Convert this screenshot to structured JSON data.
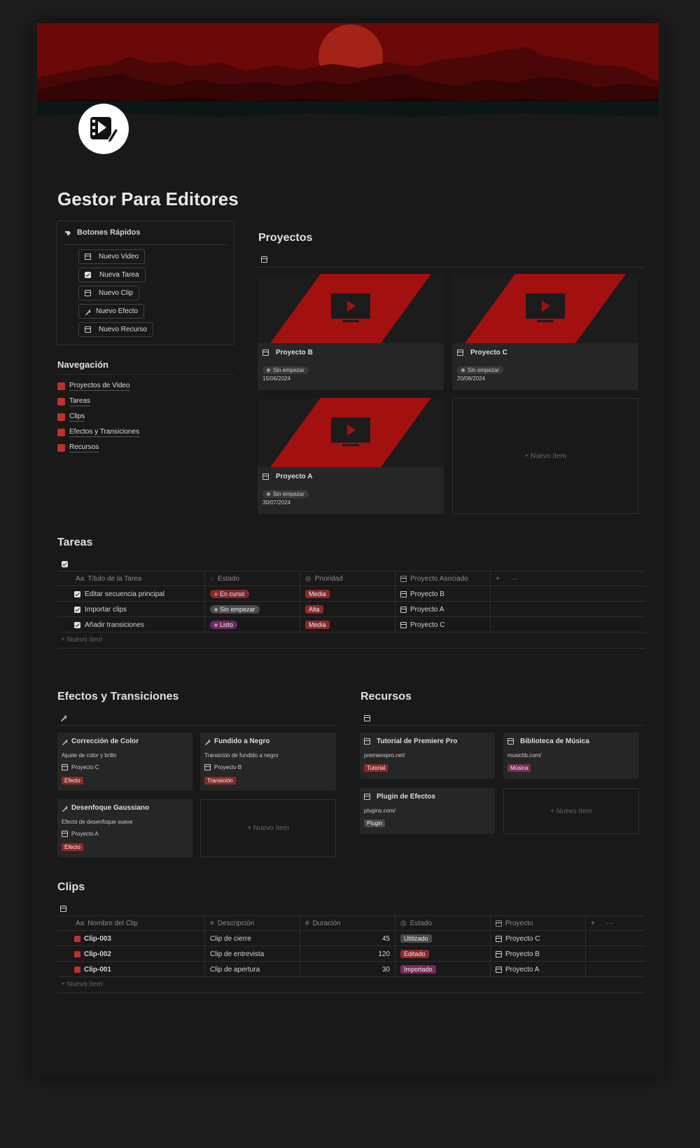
{
  "page": {
    "title": "Gestor Para Editores",
    "icon": "video-edit-icon"
  },
  "quick_buttons": {
    "title": "Botones Rápidos",
    "items": [
      {
        "label": "Nuevo Video",
        "icon": "page-icon"
      },
      {
        "label": "Nueva Tarea",
        "icon": "checkbox-icon"
      },
      {
        "label": "Nuevo Clip",
        "icon": "clapperboard-icon"
      },
      {
        "label": "Nuevo Efecto",
        "icon": "magic-wand-icon"
      },
      {
        "label": "Nuevo Recurso",
        "icon": "media-icon"
      }
    ]
  },
  "navigation": {
    "title": "Navegación",
    "items": [
      {
        "label": "Proyectos de Video"
      },
      {
        "label": "Tareas"
      },
      {
        "label": "Clips"
      },
      {
        "label": "Efectos y Transiciones"
      },
      {
        "label": "Recursos"
      }
    ]
  },
  "projects": {
    "title": "Proyectos",
    "cards": [
      {
        "name": "Proyecto B",
        "status": "Sin empezar",
        "date": "15/06/2024"
      },
      {
        "name": "Proyecto C",
        "status": "Sin empezar",
        "date": "20/08/2024"
      },
      {
        "name": "Proyecto A",
        "status": "Sin empezar",
        "date": "30/07/2024"
      }
    ],
    "new_item": "+ Nuevo ítem"
  },
  "tasks": {
    "title": "Tareas",
    "columns": [
      "Título de la Tarea",
      "Estado",
      "Prioridad",
      "Proyecto Asociado"
    ],
    "column_prefix": "Aa",
    "rows": [
      {
        "title": "Editar secuencia principal",
        "status": "En curso",
        "priority": "Media",
        "project": "Proyecto B"
      },
      {
        "title": "Importar clips",
        "status": "Sin empezar",
        "priority": "Alta",
        "project": "Proyecto A"
      },
      {
        "title": "Añadir transiciones",
        "status": "Listo",
        "priority": "Media",
        "project": "Proyecto C"
      }
    ],
    "add_col": "+",
    "more": "···",
    "new_item": "+ Nuevo ítem"
  },
  "effects": {
    "title": "Efectos y Transiciones",
    "cards": [
      {
        "name": "Corrección de Color",
        "desc": "Ajuste de color y brillo",
        "project": "Proyecto C",
        "tag": "Efecto"
      },
      {
        "name": "Fundido a Negro",
        "desc": "Transición de fundido a negro",
        "project": "Proyecto B",
        "tag": "Transición"
      },
      {
        "name": "Desenfoque Gaussiano",
        "desc": "Efecto de desenfoque suave",
        "project": "Proyecto A",
        "tag": "Efecto"
      }
    ],
    "new_item": "+ Nuevo ítem"
  },
  "resources": {
    "title": "Recursos",
    "cards": [
      {
        "name": "Tutorial de Premiere Pro",
        "url": "premierepro.net/",
        "tag": "Tutorial"
      },
      {
        "name": "Biblioteca de Música",
        "url": "musiclib.com/",
        "tag": "Música"
      },
      {
        "name": "Plugin de Efectos",
        "url": "plugins.com/",
        "tag": "Plugin"
      }
    ],
    "new_item": "+ Nuevo ítem"
  },
  "clips": {
    "title": "Clips",
    "columns": [
      "Nombre del Clip",
      "Descripción",
      "Duración",
      "Estado",
      "Proyecto"
    ],
    "column_prefix": "Aa",
    "duration_prefix": "#",
    "rows": [
      {
        "name": "Clip-003",
        "desc": "Clip de cierre",
        "duration": "45",
        "status": "Utilizado",
        "project": "Proyecto C"
      },
      {
        "name": "Clip-002",
        "desc": "Clip de entrevista",
        "duration": "120",
        "status": "Editado",
        "project": "Proyecto B"
      },
      {
        "name": "Clip-001",
        "desc": "Clip de apertura",
        "duration": "30",
        "status": "Importado",
        "project": "Proyecto A"
      }
    ],
    "add_col": "+",
    "more": "···",
    "new_item": "+ Nuevo ítem"
  },
  "colors": {
    "background": "#191919",
    "accent": "#c0302d",
    "cover_red": "#6b0808"
  }
}
